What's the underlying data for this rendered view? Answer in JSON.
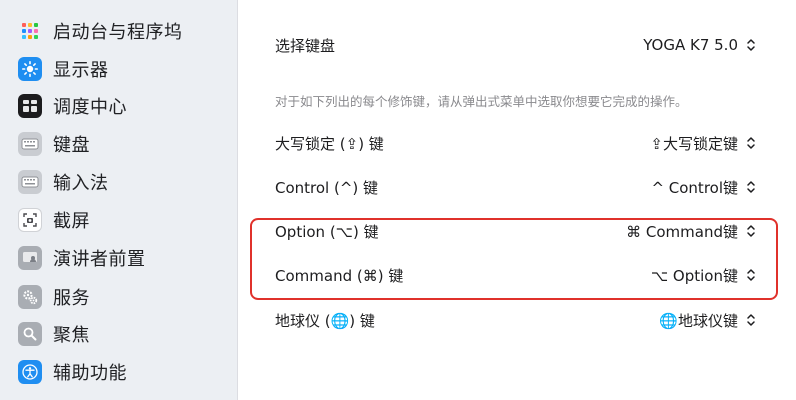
{
  "sidebar": {
    "items": [
      {
        "label": "启动台与程序坞",
        "icon": "launchpad-dock-icon"
      },
      {
        "label": "显示器",
        "icon": "brightness-icon"
      },
      {
        "label": "调度中心",
        "icon": "mission-control-icon"
      },
      {
        "label": "键盘",
        "icon": "keyboard-icon"
      },
      {
        "label": "输入法",
        "icon": "input-method-icon"
      },
      {
        "label": "截屏",
        "icon": "screenshot-icon"
      },
      {
        "label": "演讲者前置",
        "icon": "presenter-overlay-icon"
      },
      {
        "label": "服务",
        "icon": "gears-icon"
      },
      {
        "label": "聚焦",
        "icon": "magnifier-icon"
      },
      {
        "label": "辅助功能",
        "icon": "accessibility-icon"
      }
    ]
  },
  "main": {
    "keyboard_select": {
      "label": "选择键盘",
      "value": "YOGA K7 5.0"
    },
    "description": "对于如下列出的每个修饰键，请从弹出式菜单中选取你想要它完成的操作。",
    "modifiers": [
      {
        "label": "大写锁定 (⇪) 键",
        "value": "⇪大写锁定键"
      },
      {
        "label": "Control (^) 键",
        "value": "^ Control键"
      },
      {
        "label": "Option (⌥) 键",
        "value": "⌘ Command键"
      },
      {
        "label": "Command (⌘) 键",
        "value": "⌥ Option键"
      },
      {
        "label": "地球仪 (🌐) 键",
        "value": "🌐地球仪键"
      }
    ]
  },
  "colors": {
    "highlight": "#e0312b",
    "sidebar_bg": "#eceff3"
  }
}
